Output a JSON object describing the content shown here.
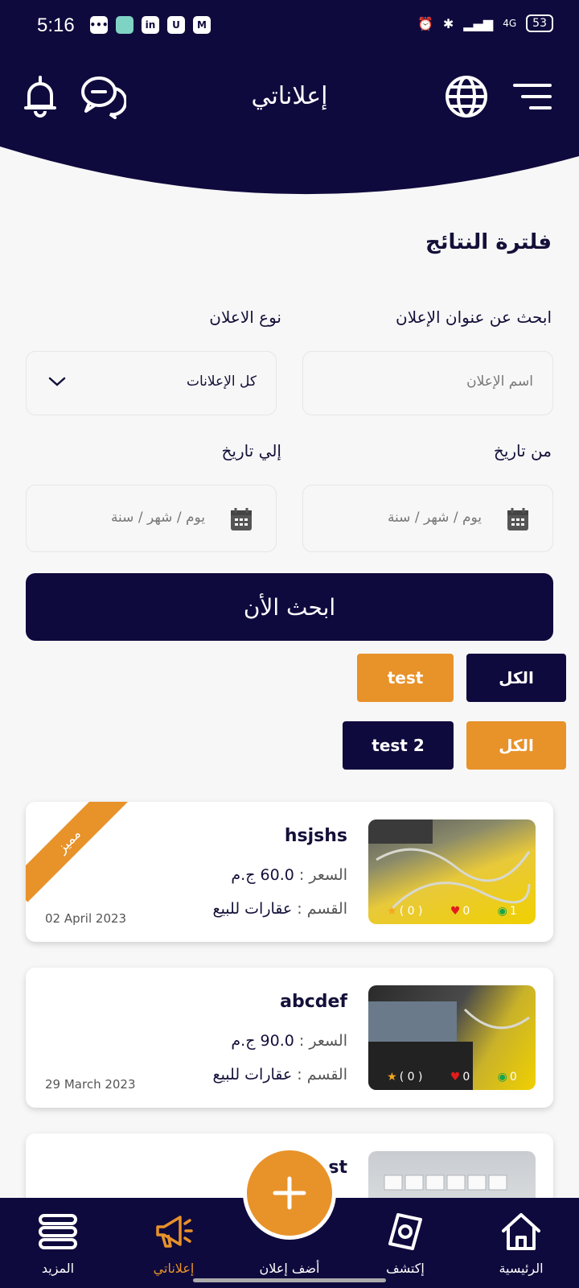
{
  "status_bar": {
    "time": "5:16",
    "battery": "53",
    "network": "4G"
  },
  "header": {
    "title": "إعلاناتي"
  },
  "filter": {
    "title": "فلترة النتائج",
    "search_label": "ابحث عن عنوان الإعلان",
    "type_label": "نوع الاعلان",
    "search_placeholder": "اسم الإعلان",
    "type_value": "كل الإعلانات",
    "from_label": "من تاريخ",
    "to_label": "إلي تاريخ",
    "from_placeholder": "يوم / شهر / سنة",
    "to_placeholder": "يوم / شهر / سنة",
    "search_button": "ابحث الأن"
  },
  "chips": {
    "row1": [
      {
        "label": "الكل"
      },
      {
        "label": "test"
      }
    ],
    "row2": [
      {
        "label": "الكل"
      },
      {
        "label": "test 2"
      }
    ]
  },
  "cards": [
    {
      "title": "hsjshs",
      "price_key": "السعر :",
      "price": "60.0 ج.م",
      "category_key": "القسم :",
      "category": "عقارات للبيع",
      "date": "02 April 2023",
      "badge": "مميز",
      "rating": "( 0 )",
      "likes": "0",
      "views": "1"
    },
    {
      "title": "abcdef",
      "price_key": "السعر :",
      "price": "90.0 ج.م",
      "category_key": "القسم :",
      "category": "عقارات للبيع",
      "date": "29 March 2023",
      "rating": "( 0 )",
      "likes": "0",
      "views": "0"
    },
    {
      "title": "test"
    }
  ],
  "nav": {
    "home": "الرئيسية",
    "explore": "إكتشف",
    "add": "أضف إعلان",
    "my_ads": "إعلاناتي",
    "more": "المزيد"
  },
  "colors": {
    "primary": "#0f0a3d",
    "accent": "#e8922a",
    "background": "#f7f7f7"
  }
}
